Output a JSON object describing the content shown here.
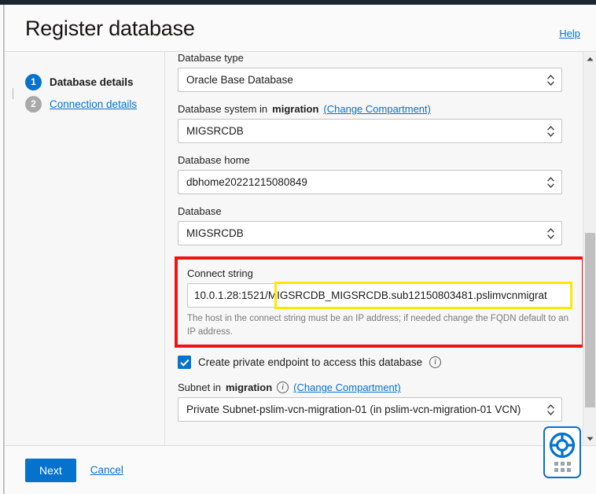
{
  "dialog": {
    "title": "Register database",
    "help_label": "Help"
  },
  "steps": [
    {
      "number": "1",
      "label": "Database details",
      "state": "active"
    },
    {
      "number": "2",
      "label": "Connection details",
      "state": "inactive"
    }
  ],
  "form": {
    "database_type": {
      "label": "Database type",
      "value": "Oracle Base Database"
    },
    "database_system": {
      "label_prefix": "Database system in",
      "label_compartment": "migration",
      "change_link": "(Change Compartment)",
      "value": "MIGSRCDB"
    },
    "database_home": {
      "label": "Database home",
      "value": "dbhome20221215080849"
    },
    "database": {
      "label": "Database",
      "value": "MIGSRCDB"
    },
    "connect_string": {
      "label": "Connect string",
      "value": "10.0.1.28:1521/MIGSRCDB_MIGSRCDB.sub12150803481.pslimvcnmigrat",
      "highlighted_part": "/MIGSRCDB_MIGSRCDB.sub12150803481.pslimvcnmigrat",
      "hint": "The host in the connect string must be an IP address; if needed change the FQDN default to an IP address."
    },
    "private_endpoint": {
      "label": "Create private endpoint to access this database",
      "checked": true,
      "info_tooltip": "info-icon"
    },
    "subnet": {
      "label_prefix": "Subnet in",
      "label_compartment": "migration",
      "change_link": "(Change Compartment)",
      "info_tooltip": "info-icon",
      "value": "Private Subnet-pslim-vcn-migration-01 (in pslim-vcn-migration-01 VCN)"
    }
  },
  "footer": {
    "next_label": "Next",
    "cancel_label": "Cancel"
  },
  "annotations": {
    "red_box_color": "#ef1414",
    "yellow_box_color": "#ffe800"
  },
  "colors": {
    "accent": "#0572ce",
    "panel_bg": "#fafafa",
    "body_bg": "#f7f7f7",
    "topbar": "#1b2630"
  },
  "widget": {
    "name": "lifesaver-help-widget"
  }
}
